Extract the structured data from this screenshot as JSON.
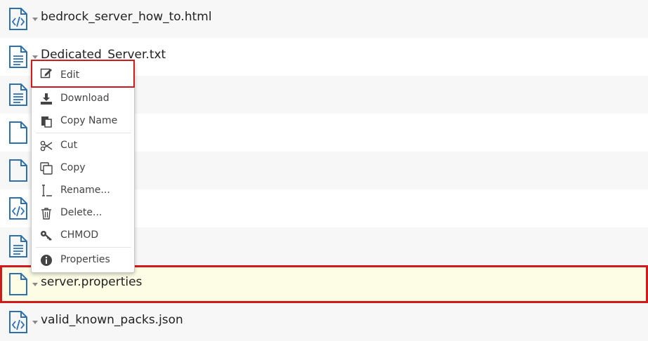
{
  "files": [
    {
      "name": "bedrock_server_how_to.html",
      "icon": "code-file-icon"
    },
    {
      "name": "Dedicated_Server.txt",
      "icon": "text-file-icon"
    },
    {
      "name": "",
      "icon": "text-file-icon"
    },
    {
      "name": "",
      "icon": "blank-file-icon"
    },
    {
      "name": "",
      "icon": "blank-file-icon"
    },
    {
      "name": "",
      "icon": "code-file-icon"
    },
    {
      "name": "",
      "icon": "text-file-icon"
    },
    {
      "name": "server.properties",
      "icon": "blank-file-icon"
    },
    {
      "name": "valid_known_packs.json",
      "icon": "code-file-icon"
    }
  ],
  "context_menu": {
    "edit": "Edit",
    "download": "Download",
    "copy_name": "Copy Name",
    "cut": "Cut",
    "copy": "Copy",
    "rename": "Rename...",
    "delete": "Delete...",
    "chmod": "CHMOD",
    "properties": "Properties"
  },
  "colors": {
    "icon_blue": "#2e6fb0",
    "highlight_red": "#d11a1a",
    "selected_row_bg": "#fdfde6"
  }
}
